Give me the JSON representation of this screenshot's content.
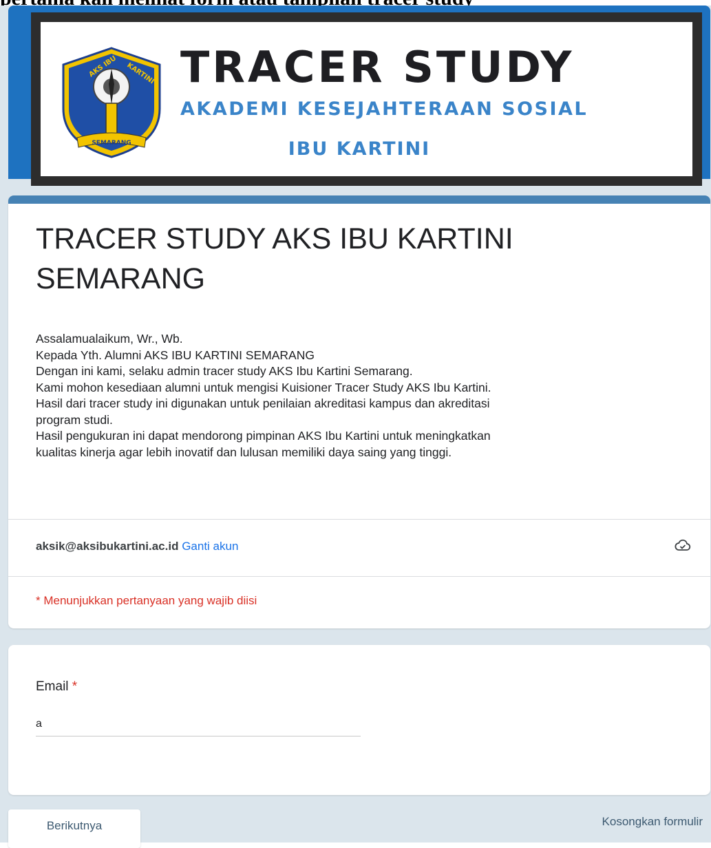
{
  "top_cut_text": "pertama kali melihat form atau tampilan tracer study",
  "banner": {
    "title": "TRACER STUDY",
    "subtitle_line1": "AKADEMI KESEJAHTERAAN SOSIAL",
    "subtitle_line2": "IBU KARTINI",
    "logo_text_top": "AKS IBU KARTINI",
    "logo_text_bottom": "SEMARANG"
  },
  "form": {
    "title_line1": "TRACER STUDY AKS IBU KARTINI",
    "title_line2": "SEMARANG",
    "description": [
      "Assalamualaikum, Wr., Wb.",
      "Kepada Yth. Alumni AKS IBU KARTINI SEMARANG",
      "Dengan ini kami, selaku admin tracer study AKS Ibu Kartini Semarang.",
      "Kami mohon kesediaan alumni untuk mengisi Kuisioner Tracer Study AKS Ibu Kartini.",
      "Hasil dari tracer study ini digunakan untuk penilaian akreditasi kampus dan akreditasi",
      "program studi.",
      "Hasil pengukuran ini dapat mendorong pimpinan AKS Ibu Kartini untuk meningkatkan",
      "kualitas kinerja agar lebih inovatif dan lulusan memiliki daya saing yang tinggi."
    ],
    "account_email": "aksik@aksibukartini.ac.id",
    "switch_account": "Ganti akun",
    "required_note": "* Menunjukkan pertanyaan yang wajib diisi"
  },
  "question": {
    "label": "Email",
    "required_mark": "*",
    "value": "a"
  },
  "actions": {
    "next": "Berikutnya",
    "clear": "Kosongkan formulir"
  },
  "colors": {
    "accent": "#4682b4",
    "banner_blue": "#3a84c9",
    "required": "#d93025",
    "link": "#1a73e8",
    "page_bg": "#dbe5ec"
  }
}
